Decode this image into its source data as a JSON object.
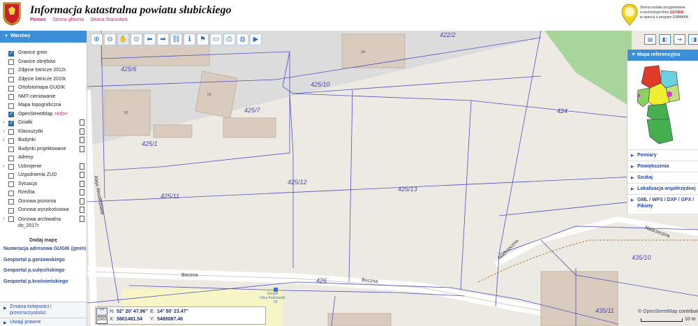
{
  "header": {
    "title": "Informacja katastralna powiatu słubickiego",
    "help": "Pomoc",
    "home": "Strona główna",
    "office": "Strona Starostwa",
    "geobid_logo_text": "GEOBID",
    "credit_line1": "Strona została przygotowana",
    "credit_line2_prefix": "w technologii firmy ",
    "credit_line2_brand": "GEOBID",
    "credit_line3": "w oparciu o program EWMAPA"
  },
  "sidebar": {
    "header": "Warstwy",
    "layers": [
      {
        "label": "Granice gmin",
        "checked": true,
        "expandable": false,
        "doc": false
      },
      {
        "label": "Granice obrębów",
        "checked": false,
        "expandable": false,
        "doc": false
      },
      {
        "label": "Zdjęcie lotnicze 2012r.",
        "checked": false,
        "expandable": false,
        "doc": false
      },
      {
        "label": "Zdjęcie lotnicze 2019r.",
        "checked": false,
        "expandable": false,
        "doc": false
      },
      {
        "label": "Ortofotomapa GUGIK",
        "checked": false,
        "expandable": false,
        "doc": false
      },
      {
        "label": "NMT-cieniowanie",
        "checked": false,
        "expandable": false,
        "doc": false
      },
      {
        "label": "Mapa topograficzna",
        "checked": false,
        "expandable": false,
        "doc": false
      },
      {
        "label": "OpenStreetMap",
        "info": ">Info<",
        "checked": true,
        "expandable": false,
        "doc": false
      },
      {
        "label": "Działki",
        "checked": true,
        "expandable": true,
        "doc": true
      },
      {
        "label": "Klasoużytki",
        "checked": false,
        "expandable": true,
        "doc": true
      },
      {
        "label": "Budynki",
        "checked": false,
        "expandable": true,
        "doc": true
      },
      {
        "label": "Budynki projektowane",
        "checked": false,
        "expandable": false,
        "doc": true
      },
      {
        "label": "Adresy",
        "checked": false,
        "expandable": false,
        "doc": false
      },
      {
        "label": "Uzbrojenie",
        "checked": false,
        "expandable": true,
        "doc": true
      },
      {
        "label": "Uzgodnienia ZUD",
        "checked": false,
        "expandable": false,
        "doc": true
      },
      {
        "label": "Sytuacja",
        "checked": false,
        "expandable": false,
        "doc": true
      },
      {
        "label": "Rzeźba",
        "checked": false,
        "expandable": false,
        "doc": true
      },
      {
        "label": "Osnowa pozioma",
        "checked": false,
        "expandable": false,
        "doc": true
      },
      {
        "label": "Osnowa wysokościowa",
        "checked": false,
        "expandable": false,
        "doc": true
      },
      {
        "label": "Osnowa archiwalna do_2017r",
        "checked": false,
        "expandable": true,
        "doc": true
      }
    ],
    "add_map": "Dodaj mapę",
    "links": {
      "gugik": "Numeracja adresowa GUGIK (gmin)",
      "gorz": "Geoportal p.gorzowskiego",
      "sul": "Geoportal p.sulęcińskiego",
      "kros": "Geoportal p.krośnieńskiego"
    },
    "order_line1": "Zmiana kolejności i",
    "order_line2": "przezroczystości",
    "notes": "Uwagi prawne"
  },
  "toolbar": {
    "tools": [
      {
        "name": "zoom-in-icon",
        "glyph": "⊕"
      },
      {
        "name": "zoom-out-icon",
        "glyph": "⊖"
      },
      {
        "name": "pan-hand-icon",
        "glyph": "✋"
      },
      {
        "name": "zoom-extent-icon",
        "glyph": "⊙"
      },
      {
        "name": "back-arrow-icon",
        "glyph": "⬅"
      },
      {
        "name": "forward-arrow-icon",
        "glyph": "➡"
      },
      {
        "name": "link-icon",
        "glyph": "⛓"
      },
      {
        "name": "info-icon",
        "glyph": "ℹ"
      },
      {
        "name": "identify-icon",
        "glyph": "⚑"
      },
      {
        "name": "measure-icon",
        "glyph": "▭"
      },
      {
        "name": "print-icon",
        "glyph": "⎙"
      },
      {
        "name": "globe-icon",
        "glyph": "◍"
      },
      {
        "name": "video-icon",
        "glyph": "▶"
      }
    ]
  },
  "right_panel": {
    "header": "Mapa referencyjna",
    "items": [
      "Pomiary",
      "Powiększenia",
      "Szukaj",
      "Lokalizacja współrzędnej",
      "GML / WFS / DXF / GPX / Pikiety"
    ]
  },
  "right_tools": [
    "layout-icon",
    "sidebar-left-icon",
    "export-icon",
    "sidebar-right-icon"
  ],
  "map": {
    "parcels": [
      "425/6",
      "425/10",
      "422/2",
      "425/7",
      "424",
      "425/1",
      "425/12",
      "425/13",
      "425/11",
      "435/10",
      "426",
      "435/11"
    ],
    "streets": [
      "Aleja Westerplatte",
      "Boczna",
      "Boczna",
      "Nadrzeczna",
      "Nadrzeczna"
    ],
    "house_numbers": [
      "2A",
      "62",
      "60"
    ],
    "poi_name": "Rzepin",
    "poi_street": "Ulica Kościuszki",
    "poi_nr": "03"
  },
  "coords": {
    "crs_deg": "°'\"",
    "crs_2000": "2000",
    "n_label": "N:",
    "n_value": "52° 20' 47.96\"",
    "e_label": "E:",
    "e_value": "14° 50' 23.47\"",
    "x_label": "X:",
    "x_value": "5801481.54",
    "y_label": "Y:",
    "y_value": "5489087.46"
  },
  "attribution": {
    "prefix": "© ",
    "osm": "OpenStreetMap",
    "suffix": " contributors"
  },
  "scale": "10 m",
  "colors": {
    "accent": "#3b8fd8",
    "link": "#2649a8",
    "parcel_line": "#5050c8"
  }
}
